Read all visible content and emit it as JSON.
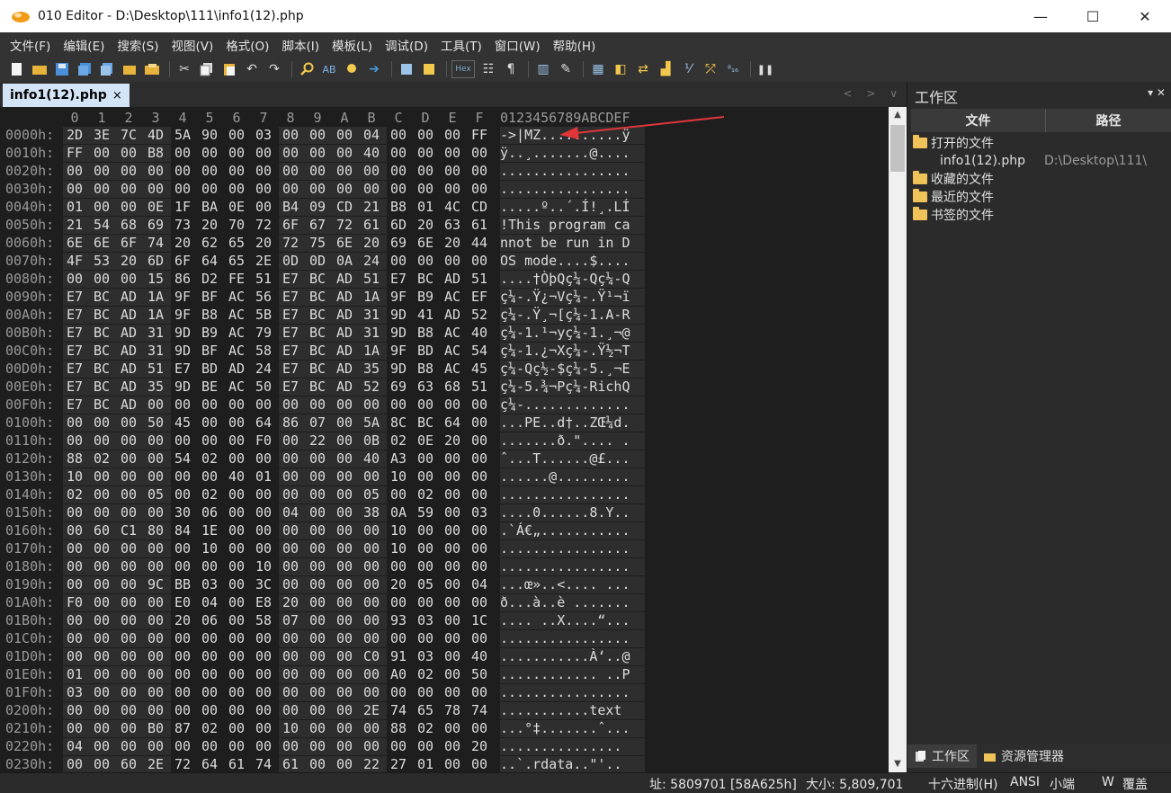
{
  "window": {
    "title": "010 Editor - D:\\Desktop\\111\\info1(12).php",
    "controls": [
      "—",
      "☐",
      "✕"
    ]
  },
  "menu": [
    "文件(F)",
    "编辑(E)",
    "搜索(S)",
    "视图(V)",
    "格式(O)",
    "脚本(I)",
    "模板(L)",
    "调试(D)",
    "工具(T)",
    "窗口(W)",
    "帮助(H)"
  ],
  "toolbar": {
    "icons": [
      "new-file-icon",
      "open-icon",
      "save-icon",
      "save-all-icon",
      "copy-file-icon",
      "folder-icon",
      "open-folder-icon",
      "cut-icon",
      "copy-icon",
      "paste-icon",
      "undo-icon",
      "redo-icon",
      "find-icon",
      "replace-icon",
      "find-in-files-icon",
      "goto-icon",
      "script-icon",
      "template-icon",
      "hex-mode-icon",
      "text-mode-icon",
      "pilcrow-icon",
      "columns-icon",
      "highlight-icon",
      "calculator-icon",
      "inspector-icon",
      "compare-icon",
      "histogram-icon",
      "checksum-icon",
      "convert-icon",
      "base-converter-icon",
      "pause-icon"
    ],
    "hex_label": "Hex",
    "pilcrow": "¶"
  },
  "tab": {
    "label": "info1(12).php",
    "close": "×"
  },
  "tab_nav": "< > ∨",
  "editor": {
    "header_hex": [
      "0",
      "1",
      "2",
      "3",
      "4",
      "5",
      "6",
      "7",
      "8",
      "9",
      "A",
      "B",
      "C",
      "D",
      "E",
      "F"
    ],
    "header_ascii": "0123456789ABCDEF",
    "rows": [
      {
        "addr": "0000h:",
        "hex": [
          "2D",
          "3E",
          "7C",
          "4D",
          "5A",
          "90",
          "00",
          "03",
          "00",
          "00",
          "00",
          "04",
          "00",
          "00",
          "00",
          "FF"
        ],
        "ascii": "->|MZ..........ÿ"
      },
      {
        "addr": "0010h:",
        "hex": [
          "FF",
          "00",
          "00",
          "B8",
          "00",
          "00",
          "00",
          "00",
          "00",
          "00",
          "00",
          "40",
          "00",
          "00",
          "00",
          "00"
        ],
        "ascii": "ÿ..¸.......@...."
      },
      {
        "addr": "0020h:",
        "hex": [
          "00",
          "00",
          "00",
          "00",
          "00",
          "00",
          "00",
          "00",
          "00",
          "00",
          "00",
          "00",
          "00",
          "00",
          "00",
          "00"
        ],
        "ascii": "................"
      },
      {
        "addr": "0030h:",
        "hex": [
          "00",
          "00",
          "00",
          "00",
          "00",
          "00",
          "00",
          "00",
          "00",
          "00",
          "00",
          "00",
          "00",
          "00",
          "00",
          "00"
        ],
        "ascii": "................"
      },
      {
        "addr": "0040h:",
        "hex": [
          "01",
          "00",
          "00",
          "0E",
          "1F",
          "BA",
          "0E",
          "00",
          "B4",
          "09",
          "CD",
          "21",
          "B8",
          "01",
          "4C",
          "CD"
        ],
        "ascii": ".....º..´.Í!¸.LÍ"
      },
      {
        "addr": "0050h:",
        "hex": [
          "21",
          "54",
          "68",
          "69",
          "73",
          "20",
          "70",
          "72",
          "6F",
          "67",
          "72",
          "61",
          "6D",
          "20",
          "63",
          "61"
        ],
        "ascii": "!This program ca"
      },
      {
        "addr": "0060h:",
        "hex": [
          "6E",
          "6E",
          "6F",
          "74",
          "20",
          "62",
          "65",
          "20",
          "72",
          "75",
          "6E",
          "20",
          "69",
          "6E",
          "20",
          "44"
        ],
        "ascii": "nnot be run in D"
      },
      {
        "addr": "0070h:",
        "hex": [
          "4F",
          "53",
          "20",
          "6D",
          "6F",
          "64",
          "65",
          "2E",
          "0D",
          "0D",
          "0A",
          "24",
          "00",
          "00",
          "00",
          "00"
        ],
        "ascii": "OS mode....$...."
      },
      {
        "addr": "0080h:",
        "hex": [
          "00",
          "00",
          "00",
          "15",
          "86",
          "D2",
          "FE",
          "51",
          "E7",
          "BC",
          "AD",
          "51",
          "E7",
          "BC",
          "AD",
          "51"
        ],
        "ascii": "....†ÒþQç¼-Qç¼-Q"
      },
      {
        "addr": "0090h:",
        "hex": [
          "E7",
          "BC",
          "AD",
          "1A",
          "9F",
          "BF",
          "AC",
          "56",
          "E7",
          "BC",
          "AD",
          "1A",
          "9F",
          "B9",
          "AC",
          "EF"
        ],
        "ascii": "ç¼-.Ÿ¿¬Vç¼-.Ÿ¹¬ï"
      },
      {
        "addr": "00A0h:",
        "hex": [
          "E7",
          "BC",
          "AD",
          "1A",
          "9F",
          "B8",
          "AC",
          "5B",
          "E7",
          "BC",
          "AD",
          "31",
          "9D",
          "41",
          "AD",
          "52"
        ],
        "ascii": "ç¼-.Ÿ¸¬[ç¼-1.A-R"
      },
      {
        "addr": "00B0h:",
        "hex": [
          "E7",
          "BC",
          "AD",
          "31",
          "9D",
          "B9",
          "AC",
          "79",
          "E7",
          "BC",
          "AD",
          "31",
          "9D",
          "B8",
          "AC",
          "40"
        ],
        "ascii": "ç¼-1.¹¬yç¼-1.¸¬@"
      },
      {
        "addr": "00C0h:",
        "hex": [
          "E7",
          "BC",
          "AD",
          "31",
          "9D",
          "BF",
          "AC",
          "58",
          "E7",
          "BC",
          "AD",
          "1A",
          "9F",
          "BD",
          "AC",
          "54"
        ],
        "ascii": "ç¼-1.¿¬Xç¼-.Ÿ½¬T"
      },
      {
        "addr": "00D0h:",
        "hex": [
          "E7",
          "BC",
          "AD",
          "51",
          "E7",
          "BD",
          "AD",
          "24",
          "E7",
          "BC",
          "AD",
          "35",
          "9D",
          "B8",
          "AC",
          "45"
        ],
        "ascii": "ç¼-Qç½-$ç¼-5.¸¬E"
      },
      {
        "addr": "00E0h:",
        "hex": [
          "E7",
          "BC",
          "AD",
          "35",
          "9D",
          "BE",
          "AC",
          "50",
          "E7",
          "BC",
          "AD",
          "52",
          "69",
          "63",
          "68",
          "51"
        ],
        "ascii": "ç¼-5.¾¬Pç¼-RichQ"
      },
      {
        "addr": "00F0h:",
        "hex": [
          "E7",
          "BC",
          "AD",
          "00",
          "00",
          "00",
          "00",
          "00",
          "00",
          "00",
          "00",
          "00",
          "00",
          "00",
          "00",
          "00"
        ],
        "ascii": "ç¼-............."
      },
      {
        "addr": "0100h:",
        "hex": [
          "00",
          "00",
          "00",
          "50",
          "45",
          "00",
          "00",
          "64",
          "86",
          "07",
          "00",
          "5A",
          "8C",
          "BC",
          "64",
          "00"
        ],
        "ascii": "...PE..d†..ZŒ¼d."
      },
      {
        "addr": "0110h:",
        "hex": [
          "00",
          "00",
          "00",
          "00",
          "00",
          "00",
          "00",
          "F0",
          "00",
          "22",
          "00",
          "0B",
          "02",
          "0E",
          "20",
          "00"
        ],
        "ascii": ".......ð.\".... ."
      },
      {
        "addr": "0120h:",
        "hex": [
          "88",
          "02",
          "00",
          "00",
          "54",
          "02",
          "00",
          "00",
          "00",
          "00",
          "00",
          "40",
          "A3",
          "00",
          "00",
          "00"
        ],
        "ascii": "ˆ...T......@£..."
      },
      {
        "addr": "0130h:",
        "hex": [
          "10",
          "00",
          "00",
          "00",
          "00",
          "00",
          "40",
          "01",
          "00",
          "00",
          "00",
          "00",
          "10",
          "00",
          "00",
          "00"
        ],
        "ascii": "......@........."
      },
      {
        "addr": "0140h:",
        "hex": [
          "02",
          "00",
          "00",
          "05",
          "00",
          "02",
          "00",
          "00",
          "00",
          "00",
          "00",
          "05",
          "00",
          "02",
          "00",
          "00"
        ],
        "ascii": "................"
      },
      {
        "addr": "0150h:",
        "hex": [
          "00",
          "00",
          "00",
          "00",
          "30",
          "06",
          "00",
          "00",
          "04",
          "00",
          "00",
          "38",
          "0A",
          "59",
          "00",
          "03"
        ],
        "ascii": "....0......8.Y.."
      },
      {
        "addr": "0160h:",
        "hex": [
          "00",
          "60",
          "C1",
          "80",
          "84",
          "1E",
          "00",
          "00",
          "00",
          "00",
          "00",
          "00",
          "10",
          "00",
          "00",
          "00"
        ],
        "ascii": ".`Á€„..........."
      },
      {
        "addr": "0170h:",
        "hex": [
          "00",
          "00",
          "00",
          "00",
          "00",
          "10",
          "00",
          "00",
          "00",
          "00",
          "00",
          "00",
          "10",
          "00",
          "00",
          "00"
        ],
        "ascii": "................"
      },
      {
        "addr": "0180h:",
        "hex": [
          "00",
          "00",
          "00",
          "00",
          "00",
          "00",
          "00",
          "10",
          "00",
          "00",
          "00",
          "00",
          "00",
          "00",
          "00",
          "00"
        ],
        "ascii": "................"
      },
      {
        "addr": "0190h:",
        "hex": [
          "00",
          "00",
          "00",
          "9C",
          "BB",
          "03",
          "00",
          "3C",
          "00",
          "00",
          "00",
          "00",
          "20",
          "05",
          "00",
          "04"
        ],
        "ascii": "...œ»..<.... ..."
      },
      {
        "addr": "01A0h:",
        "hex": [
          "F0",
          "00",
          "00",
          "00",
          "E0",
          "04",
          "00",
          "E8",
          "20",
          "00",
          "00",
          "00",
          "00",
          "00",
          "00",
          "00"
        ],
        "ascii": "ð...à..è ......."
      },
      {
        "addr": "01B0h:",
        "hex": [
          "00",
          "00",
          "00",
          "00",
          "20",
          "06",
          "00",
          "58",
          "07",
          "00",
          "00",
          "00",
          "93",
          "03",
          "00",
          "1C"
        ],
        "ascii": ".... ..X....“..."
      },
      {
        "addr": "01C0h:",
        "hex": [
          "00",
          "00",
          "00",
          "00",
          "00",
          "00",
          "00",
          "00",
          "00",
          "00",
          "00",
          "00",
          "00",
          "00",
          "00",
          "00"
        ],
        "ascii": "................"
      },
      {
        "addr": "01D0h:",
        "hex": [
          "00",
          "00",
          "00",
          "00",
          "00",
          "00",
          "00",
          "00",
          "00",
          "00",
          "00",
          "C0",
          "91",
          "03",
          "00",
          "40"
        ],
        "ascii": "...........À‘..@"
      },
      {
        "addr": "01E0h:",
        "hex": [
          "01",
          "00",
          "00",
          "00",
          "00",
          "00",
          "00",
          "00",
          "00",
          "00",
          "00",
          "00",
          "A0",
          "02",
          "00",
          "50"
        ],
        "ascii": "............ ..P"
      },
      {
        "addr": "01F0h:",
        "hex": [
          "03",
          "00",
          "00",
          "00",
          "00",
          "00",
          "00",
          "00",
          "00",
          "00",
          "00",
          "00",
          "00",
          "00",
          "00",
          "00"
        ],
        "ascii": "................"
      },
      {
        "addr": "0200h:",
        "hex": [
          "00",
          "00",
          "00",
          "00",
          "00",
          "00",
          "00",
          "00",
          "00",
          "00",
          "00",
          "2E",
          "74",
          "65",
          "78",
          "74"
        ],
        "ascii": "...........text"
      },
      {
        "addr": "0210h:",
        "hex": [
          "00",
          "00",
          "00",
          "B0",
          "87",
          "02",
          "00",
          "00",
          "10",
          "00",
          "00",
          "00",
          "88",
          "02",
          "00",
          "00"
        ],
        "ascii": "...°‡.......ˆ..."
      },
      {
        "addr": "0220h:",
        "hex": [
          "04",
          "00",
          "00",
          "00",
          "00",
          "00",
          "00",
          "00",
          "00",
          "00",
          "00",
          "00",
          "00",
          "00",
          "00",
          "20"
        ],
        "ascii": "............... "
      },
      {
        "addr": "0230h:",
        "hex": [
          "00",
          "00",
          "60",
          "2E",
          "72",
          "64",
          "61",
          "74",
          "61",
          "00",
          "00",
          "22",
          "27",
          "01",
          "00",
          "00"
        ],
        "ascii": "..`.rdata..\"'.."
      }
    ]
  },
  "workspace": {
    "title": "工作区",
    "controls": "▾ ✕",
    "col_file": "文件",
    "col_path": "路径",
    "tree": [
      {
        "label": "打开的文件",
        "icon": "folder-icon",
        "level": 0
      },
      {
        "label": "info1(12).php",
        "path": "D:\\Desktop\\111\\",
        "level": 1
      },
      {
        "label": "收藏的文件",
        "icon": "folder-icon",
        "level": 0
      },
      {
        "label": "最近的文件",
        "icon": "folder-icon",
        "level": 0
      },
      {
        "label": "书签的文件",
        "icon": "folder-icon",
        "level": 0
      }
    ],
    "bottom_tabs": [
      "工作区",
      "资源管理器"
    ]
  },
  "status": {
    "address": "址: 5809701 [58A625h]",
    "size": "大小: 5,809,701",
    "mode": "十六进制(H)",
    "encoding": "ANSI",
    "endian": "小端",
    "w": "W",
    "overwrite": "覆盖"
  },
  "colors": {
    "accent_tab": "#d4e4f7",
    "annotation_arrow": "#e0363a",
    "folder": "#f0c35a"
  }
}
